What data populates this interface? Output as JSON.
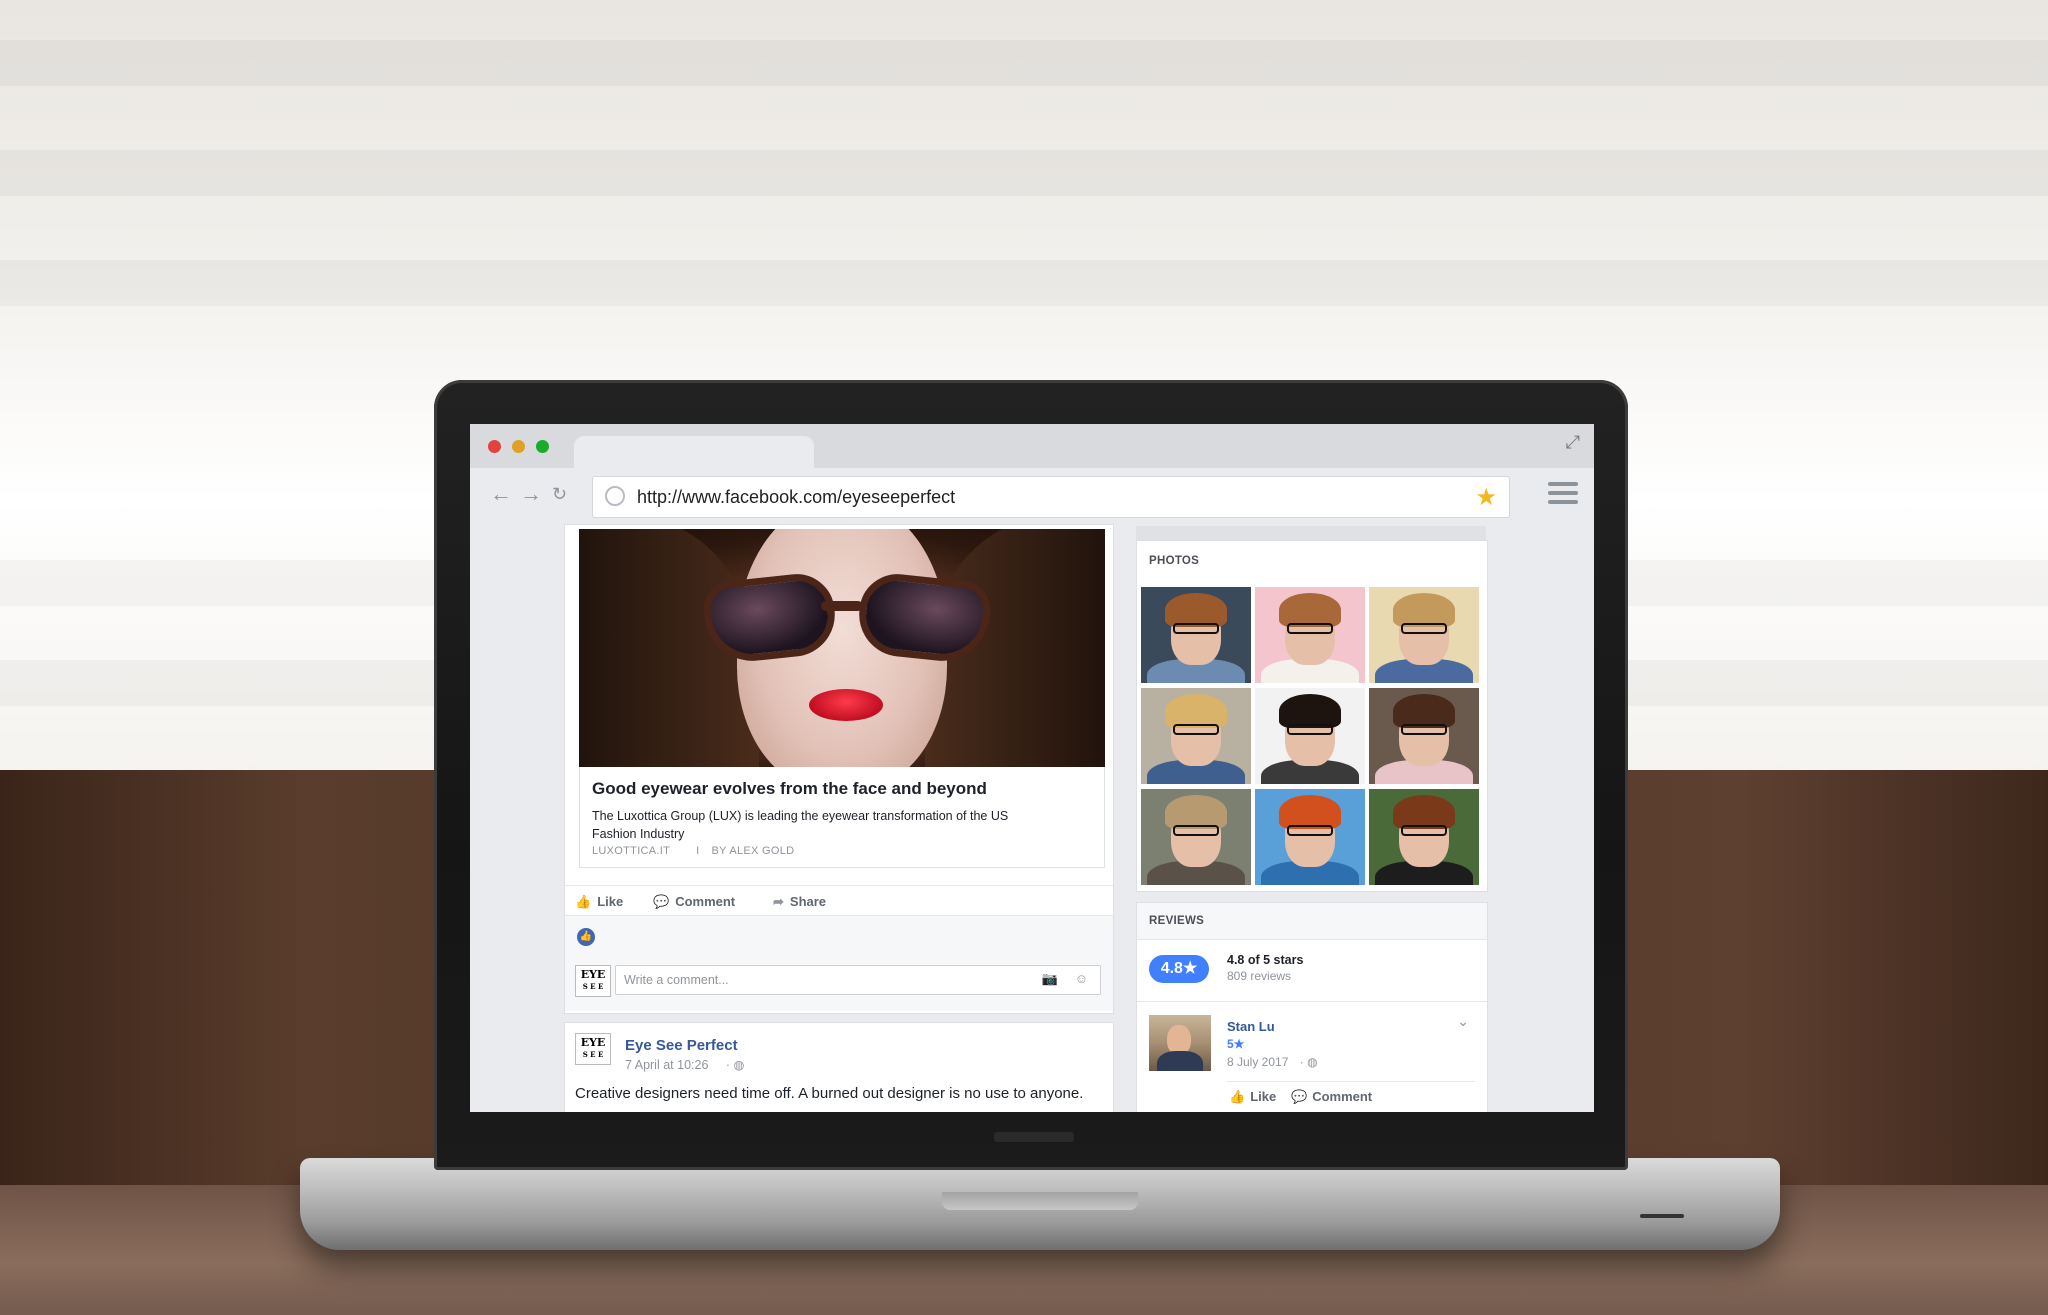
{
  "browser": {
    "url": "http://www.facebook.com/eyeseeperfect",
    "traffic_lights": {
      "close": "#e0443e",
      "minimize": "#dea123",
      "zoom": "#1aab29"
    },
    "icons": {
      "back": "arrow-left-icon",
      "forward": "arrow-right-icon",
      "reload": "reload-icon",
      "bookmark": "star-icon",
      "menu": "hamburger-menu-icon",
      "site": "globe-icon",
      "expand": "expand-icon"
    }
  },
  "feed": {
    "link_post": {
      "title": "Good eyewear evolves from the face and beyond",
      "description": "The Luxottica Group (LUX) is leading the eyewear transformation of the US Fashion Industry",
      "source": "LUXOTTICA.IT",
      "separator": "I",
      "byline": "BY ALEX GOLD",
      "actions": {
        "like": "Like",
        "comment": "Comment",
        "share": "Share"
      },
      "comment_placeholder": "Write a comment..."
    },
    "second_post": {
      "page_logo": {
        "line1": "EYE",
        "line2": "S E E"
      },
      "author": "Eye See Perfect",
      "date": "7 April at 10:26",
      "visibility_sep": "·",
      "text": "Creative designers need time off. A burned out designer is no use to anyone."
    }
  },
  "sidebar": {
    "photos": {
      "title": "PHOTOS",
      "tiles": [
        {
          "bg": "#3b4a5a",
          "hair": "#9b5a2c",
          "body": "#6b8bb0"
        },
        {
          "bg": "#f4c5cd",
          "hair": "#a8683a",
          "body": "#f4f1ec"
        },
        {
          "bg": "#e8d9b0",
          "hair": "#c49a5c",
          "body": "#4a6aa0"
        },
        {
          "bg": "#b8b0a0",
          "hair": "#d9b36a",
          "body": "#3f5f8f"
        },
        {
          "bg": "#f2f2f2",
          "hair": "#1d1410",
          "body": "#3a3a3a"
        },
        {
          "bg": "#6a5a4e",
          "hair": "#4a2a1a",
          "body": "#e8c4c8"
        },
        {
          "bg": "#7c8070",
          "hair": "#b89a70",
          "body": "#5a5248"
        },
        {
          "bg": "#5aa0d8",
          "hair": "#d1501e",
          "body": "#2e6fb0"
        },
        {
          "bg": "#4a6a3a",
          "hair": "#7a3a1a",
          "body": "#1d1d1d"
        }
      ]
    },
    "reviews": {
      "title": "REVIEWS",
      "score": "4.8★",
      "summary": "4.8 of 5 stars",
      "count": "809 reviews",
      "review": {
        "name": "Stan Lu",
        "stars": "5★",
        "date": "8 July 2017",
        "visibility_sep": "·",
        "actions": {
          "like": "Like",
          "comment": "Comment"
        }
      }
    }
  }
}
